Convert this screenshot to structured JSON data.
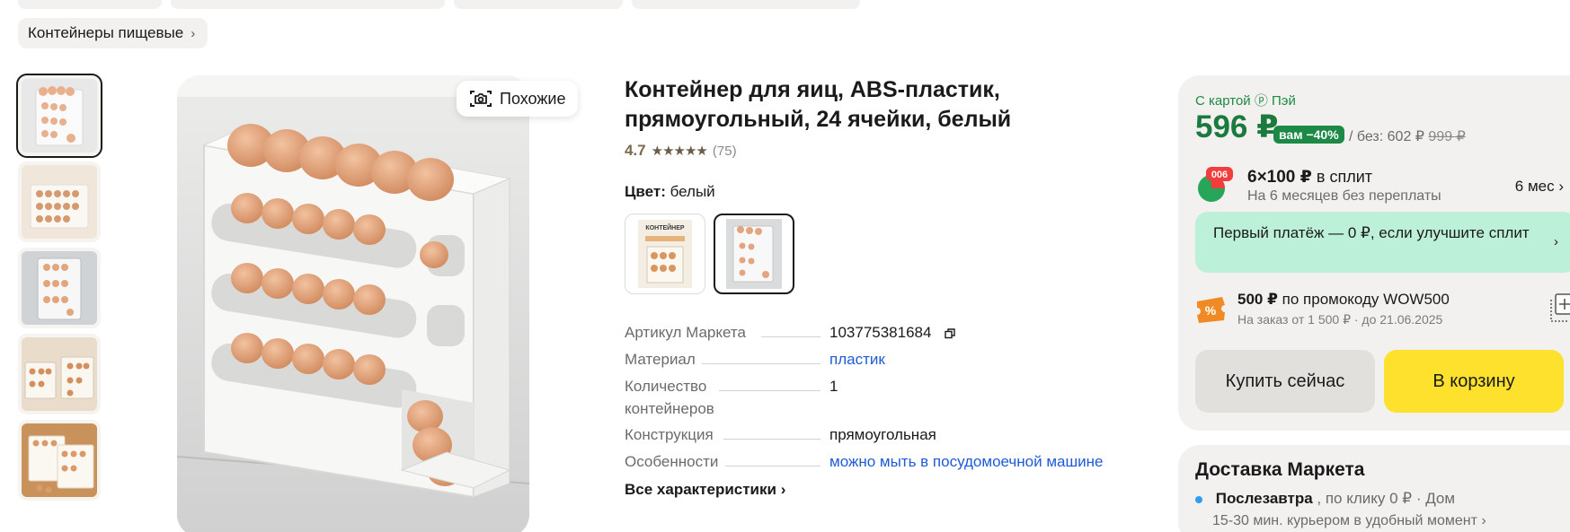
{
  "breadcrumb": {
    "label": "Контейнеры пищевые"
  },
  "similar_button": {
    "label": "Похожие"
  },
  "product": {
    "title": "Контейнер для яиц, ABS-пластик, прямоугольный, 24 ячейки, белый",
    "rating": "4.7",
    "stars": "★★★★★",
    "reviews_count": "(75)"
  },
  "color": {
    "label": "Цвет:",
    "value": "белый",
    "swatch_1_text": "КОНТЕЙНЕР"
  },
  "specs": [
    {
      "key": "Артикул Маркета",
      "value": "103775381684"
    },
    {
      "key": "Материал",
      "value": "пластик"
    },
    {
      "key": "Количество контейнеров",
      "value": "1"
    },
    {
      "key": "Конструкция",
      "value": "прямоугольная"
    },
    {
      "key": "Особенности",
      "value": "можно мыть в посудомоечной машине"
    }
  ],
  "all_specs": "Все характеристики",
  "buy": {
    "pay_label": "С картой ⓟ Пэй",
    "price": "596 ₽",
    "discount_badge": "вам −40%",
    "without_label": "/ без: 602 ₽",
    "old_price": "999 ₽",
    "split_badge": "006",
    "split_amount": "6×100 ₽",
    "split_suffix": "в сплит",
    "split_sub": "На 6 месяцев без переплаты",
    "split_term": "6 мес",
    "first_payment": "Первый платёж — 0 ₽, если улучшите сплит",
    "promo_amount": "500 ₽",
    "promo_text": "по промокоду WOW500",
    "promo_sub": "На заказ от 1 500 ₽ · до 21.06.2025",
    "buy_now": "Купить сейчас",
    "add_to_cart": "В корзину"
  },
  "delivery": {
    "title": "Доставка Маркета",
    "option": "Послезавтра",
    "option_details": ", по клику 0 ₽ · Дом",
    "sub": "15-30 мин. курьером в удобный момент"
  },
  "colors": {
    "accent_green": "#1c8a46",
    "link_blue": "#1f5bd6",
    "cart_yellow": "#fde12d",
    "split_green": "#bdf0d8"
  }
}
